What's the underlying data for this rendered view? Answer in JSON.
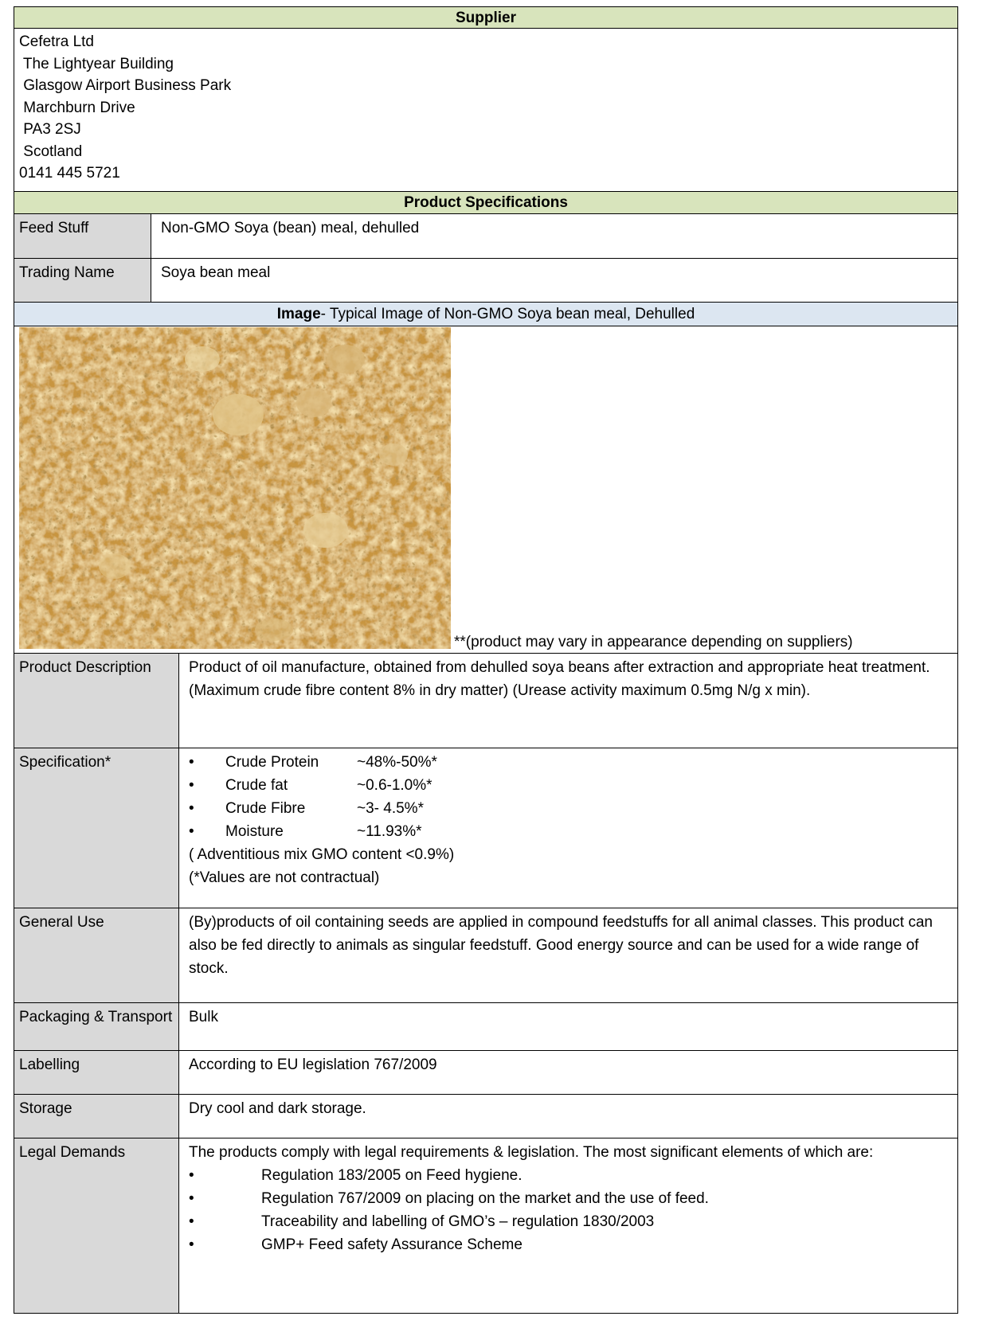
{
  "supplier": {
    "header": "Supplier",
    "lines": [
      "Cefetra Ltd",
      " The Lightyear Building",
      " Glasgow Airport Business Park",
      " Marchburn Drive",
      " PA3 2SJ",
      " Scotland",
      "0141 445 5721"
    ]
  },
  "specs_header": "Product Specifications",
  "feed_stuff": {
    "label": "Feed Stuff",
    "value": "Non-GMO Soya (bean) meal, dehulled"
  },
  "trading_name": {
    "label": "Trading Name",
    "value": "Soya bean meal"
  },
  "image_section": {
    "header_bold": "Image",
    "header_rest": "- Typical Image of Non-GMO Soya bean meal, Dehulled",
    "caption": "**(product may vary in appearance depending on suppliers)"
  },
  "product_description": {
    "label": "Product Description",
    "value": "Product of oil manufacture, obtained from dehulled soya beans after extraction and appropriate heat treatment. (Maximum crude fibre content 8% in dry matter) (Urease activity maximum 0.5mg N/g x min)."
  },
  "specification": {
    "label": "Specification*",
    "items": [
      {
        "bullet": "•",
        "name": "Crude Protein",
        "value": "~48%-50%*"
      },
      {
        "bullet": "•",
        "name": "Crude fat",
        "value": "~0.6-1.0%*"
      },
      {
        "bullet": "•",
        "name": "Crude Fibre",
        "value": "~3- 4.5%*"
      },
      {
        "bullet": "•",
        "name": "Moisture",
        "value": "~11.93%*"
      }
    ],
    "note1": "( Adventitious mix GMO content <0.9%)",
    "note2": "(*Values are not contractual)"
  },
  "general_use": {
    "label": "General Use",
    "value": "(By)products of oil containing seeds are applied in compound feedstuffs for all animal classes.  This product can also be fed directly to animals as singular feedstuff. Good energy source and can be used for a wide range of stock."
  },
  "packaging": {
    "label": "Packaging & Transport",
    "value": "Bulk"
  },
  "labelling": {
    "label": "Labelling",
    "value": "According to EU legislation 767/2009"
  },
  "storage": {
    "label": "Storage",
    "value": "Dry cool and dark storage."
  },
  "legal": {
    "label": "Legal Demands",
    "intro": "The products comply with legal requirements & legislation.  The most significant elements of which are:",
    "items": [
      {
        "bullet": "•",
        "text": "Regulation 183/2005 on Feed hygiene."
      },
      {
        "bullet": "•",
        "text": "Regulation 767/2009 on placing on the market and the use of feed."
      },
      {
        "bullet": "•",
        "text": "Traceability and labelling of GMO’s – regulation 1830/2003"
      },
      {
        "bullet": "•",
        "text": "GMP+ Feed safety Assurance Scheme"
      }
    ]
  }
}
